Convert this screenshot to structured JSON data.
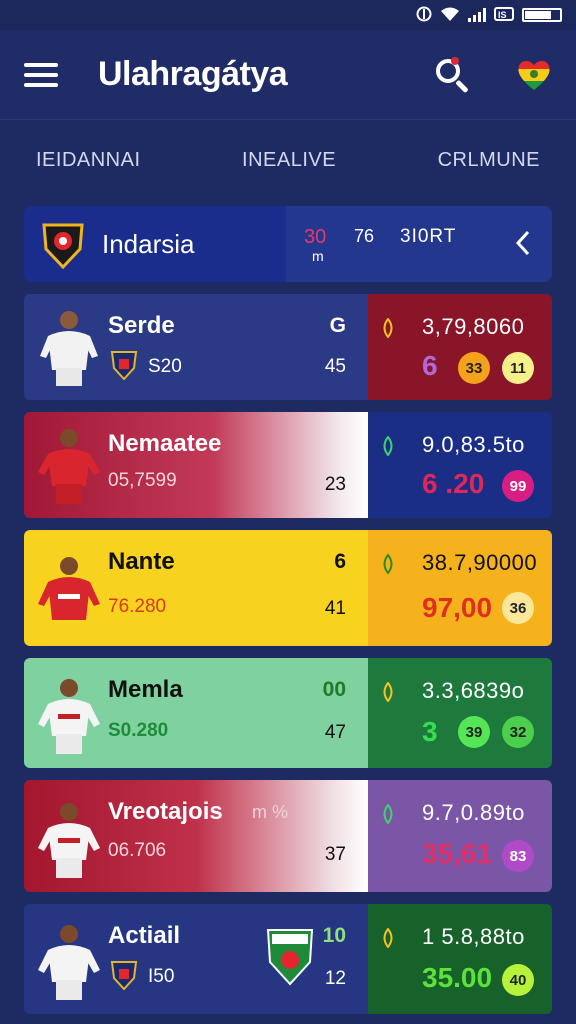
{
  "status": {
    "icon1": "N-icon",
    "icon2": "wifi-icon",
    "icon3": "signal-icon",
    "icon4": "battery-icon",
    "label": "IS"
  },
  "app": {
    "title": "Ulahragátya"
  },
  "tabs": [
    "IEIDANNAI",
    "INEALIVE",
    "CRLMUNE"
  ],
  "header": {
    "team": "Indarsia",
    "stat_a": "30",
    "stat_b": "m",
    "stat_c": "76",
    "stat_d": "3I0RT"
  },
  "rows": [
    {
      "name": "Serde",
      "sub": "S20",
      "num_top": "G",
      "num_bot": "45",
      "rv_top": "3,79,8060",
      "rv_big": "6",
      "chips": [
        "33",
        "11"
      ],
      "colors": {
        "left": "#2b3a85",
        "right": "#8a1428",
        "rvbig": "#b06ad8",
        "chip1": "#f4a21e",
        "chip2": "#f6f08a"
      }
    },
    {
      "name": "Nemaatee",
      "sub": "05,7599",
      "num_top": "",
      "num_bot": "23",
      "rv_top": "9.0,83.5to",
      "rv_big": "6 .20",
      "chips": [
        "99"
      ],
      "colors": {
        "left": "#a11836",
        "right": "#1b2e86",
        "rvbig": "#e0265a",
        "chip1": "#d81d83"
      }
    },
    {
      "name": "Nante",
      "sub": "76.280",
      "num_top": "6",
      "num_bot": "41",
      "rv_top": "38.7,90000",
      "rv_big": "97,00",
      "chips": [
        "36"
      ],
      "colors": {
        "left": "#f7d320",
        "right": "#f5b21d",
        "rvbig": "#e0301d",
        "chip1": "#fbe79a"
      }
    },
    {
      "name": "Memla",
      "sub": "S0.280",
      "num_top": "00",
      "num_bot": "47",
      "rv_top": "3.3,6839o",
      "rv_big": "3",
      "chips": [
        "39",
        "32"
      ],
      "colors": {
        "left": "#7fd2a0",
        "right": "#1e7a3c",
        "rvbig": "#35e050",
        "chip1": "#55e655",
        "chip2": "#4ccf4c"
      }
    },
    {
      "name": "Vreotajois",
      "sub": "06.706",
      "num_top": "",
      "num_bot": "37",
      "rv_top": "9.7,0.89to",
      "rv_big": "35,61",
      "chips": [
        "83"
      ],
      "extra": "m %",
      "colors": {
        "left": "#a2162e",
        "right": "#7b55a6",
        "rvbig": "#e0306a",
        "chip1": "#b04bc8"
      }
    },
    {
      "name": "Actiail",
      "sub": "I50",
      "num_top": "10",
      "num_bot": "12",
      "rv_top": "1 5.8,88to",
      "rv_big": "35.00",
      "chips": [
        "40"
      ],
      "colors": {
        "left": "#263682",
        "right": "#17612a",
        "rvbig": "#5de23a",
        "chip1": "#b6f23a"
      }
    }
  ]
}
